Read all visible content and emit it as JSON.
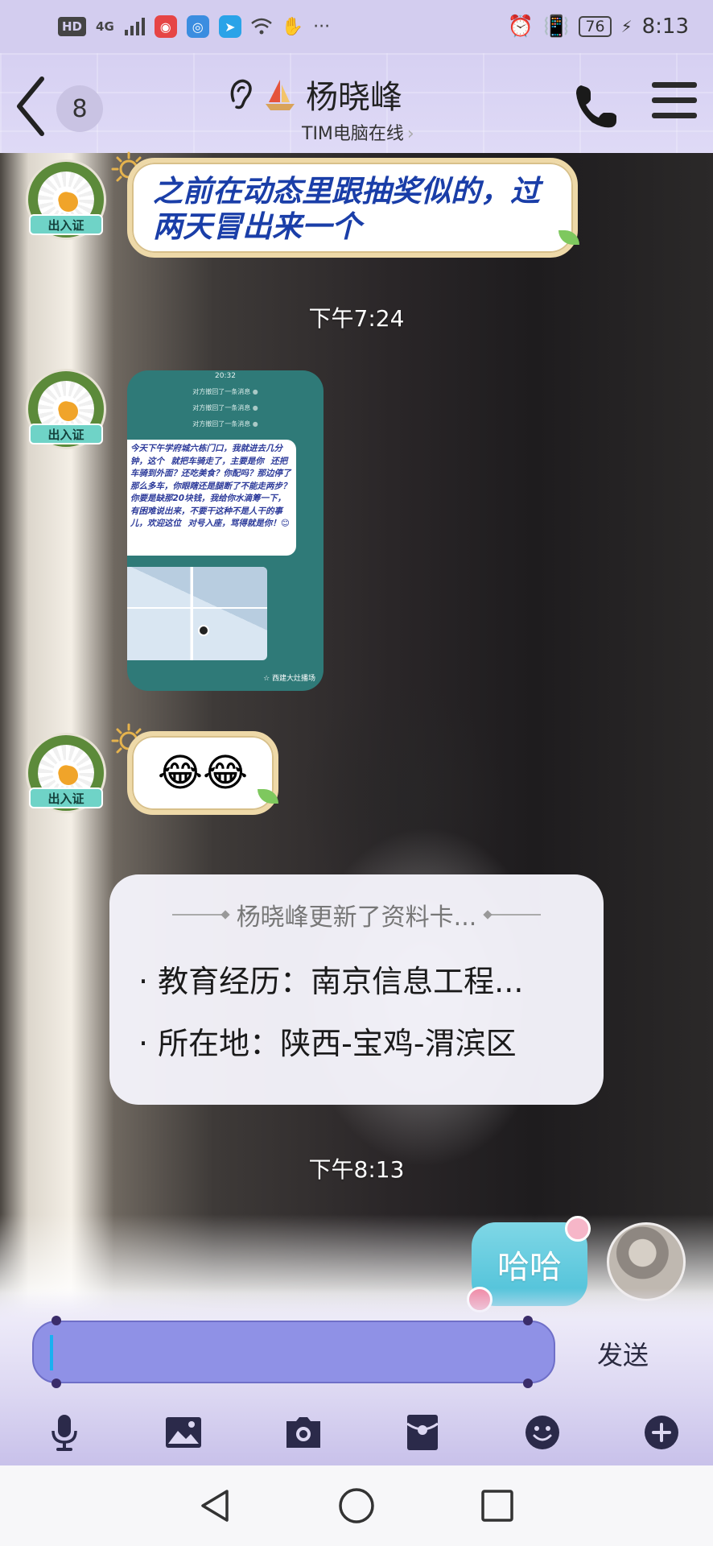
{
  "status_bar": {
    "hd": "HD",
    "network": "4G",
    "time": "8:13",
    "battery": "76",
    "more": "···"
  },
  "header": {
    "unread_count": "8",
    "contact_name": "杨晓峰",
    "contact_status": "TIM电脑在线",
    "status_chevron": "›"
  },
  "messages": {
    "text_message": "之前在动态里跟抽奖似的，过两天冒出来一个",
    "pass_badge": "出入证",
    "time_1": "下午7:24",
    "screenshot": {
      "time": "20:32",
      "recalled_lines": [
        "对方撤回了一条消息",
        "对方撤回了一条消息",
        "对方撤回了一条消息"
      ],
      "body": "今天下午学府城六栋门口，我就进去几分钟，这个    就把车骑走了，主要是你    还把车骑到外面？还吃美食？你配吗？那边停了那么多车，你眼瞎还是腿断了不能走两步？你要是缺那20块钱，我给你水滴筹一下，有困难说出来，不要干这种不是人干的事儿，欢迎这位    对号入座，骂得就是你！😊",
      "map_caption": "☆ 西建大灶播场"
    },
    "emoji_message": "😂😂",
    "profile_card": {
      "title": "杨晓峰更新了资料卡...",
      "education": "· 教育经历：南京信息工程...",
      "location": "· 所在地：陕西-宝鸡-渭滨区"
    },
    "time_2": "下午8:13",
    "sent_message": "哈哈"
  },
  "input": {
    "value": "",
    "send_label": "发送"
  },
  "icons": {
    "toolbar": [
      "microphone-icon",
      "image-icon",
      "camera-icon",
      "red-packet-icon",
      "emoji-icon",
      "plus-icon"
    ],
    "nav": [
      "back-triangle-icon",
      "home-circle-icon",
      "recents-square-icon"
    ]
  },
  "colors": {
    "header_bg": "#d6d0f2",
    "input_box": "#8f91e6",
    "sent_bubble": "#4cc0d8",
    "text_bubble_text": "#1a3ea8",
    "caret": "#1ab0f0"
  }
}
